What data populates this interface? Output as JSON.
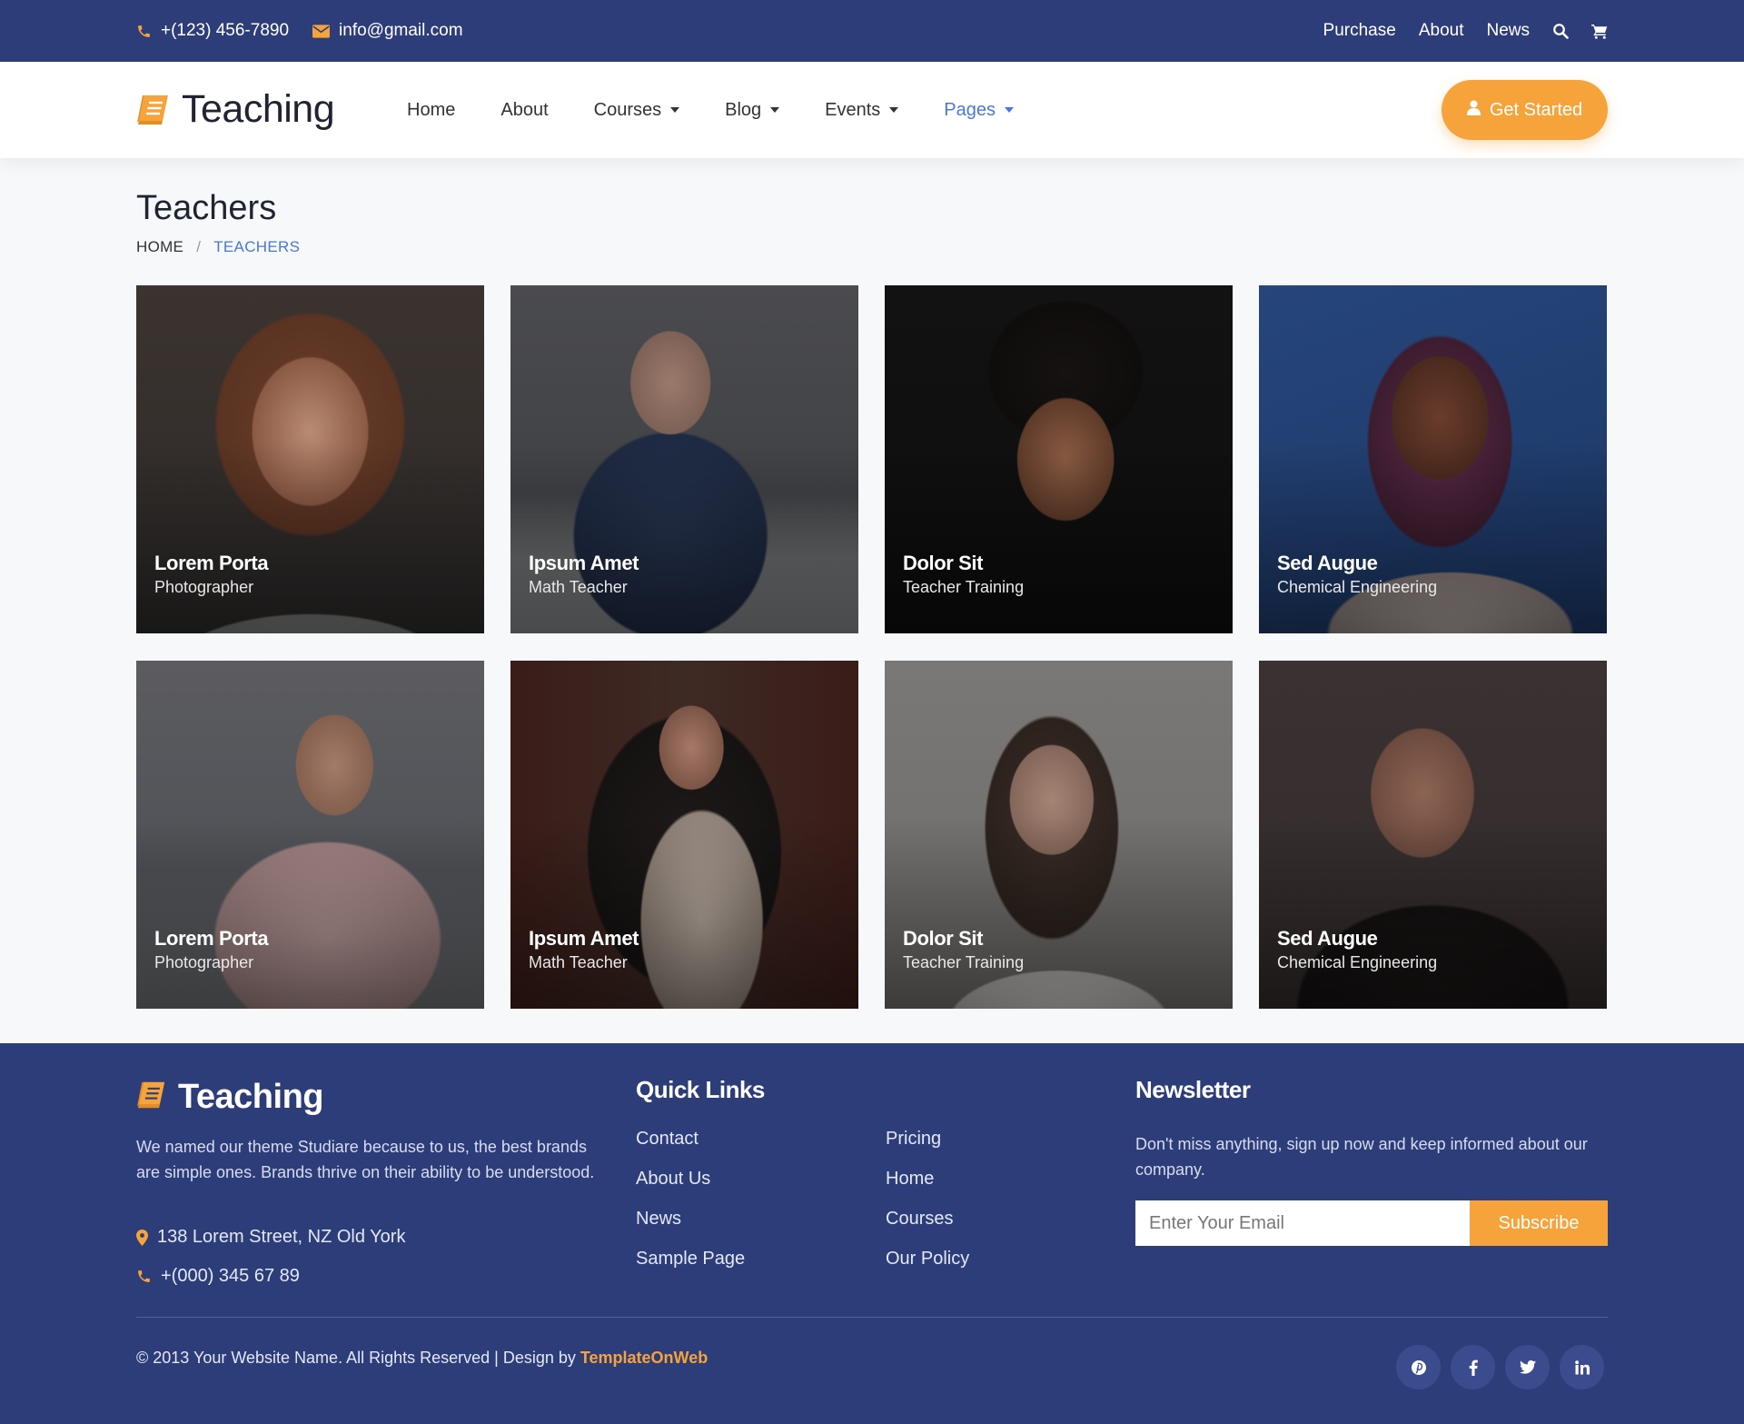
{
  "topbar": {
    "phone": "+(123) 456-7890",
    "email": "info@gmail.com",
    "links": [
      "Purchase",
      "About",
      "News"
    ],
    "icons": [
      "search-icon",
      "cart-icon"
    ]
  },
  "navbar": {
    "brand": "Teaching",
    "menu": [
      {
        "label": "Home",
        "dropdown": false
      },
      {
        "label": "About",
        "dropdown": false
      },
      {
        "label": "Courses",
        "dropdown": true
      },
      {
        "label": "Blog",
        "dropdown": true
      },
      {
        "label": "Events",
        "dropdown": true
      },
      {
        "label": "Pages",
        "dropdown": true,
        "active": true
      }
    ],
    "cta_label": "Get Started"
  },
  "page": {
    "title": "Teachers",
    "breadcrumb": {
      "home": "HOME",
      "separator": "/",
      "current": "TEACHERS"
    }
  },
  "teachers": [
    {
      "name": "Lorem Porta",
      "role": "Photographer"
    },
    {
      "name": "Ipsum Amet",
      "role": "Math Teacher"
    },
    {
      "name": "Dolor Sit",
      "role": "Teacher Training"
    },
    {
      "name": "Sed Augue",
      "role": "Chemical Engineering"
    },
    {
      "name": "Lorem Porta",
      "role": "Photographer"
    },
    {
      "name": "Ipsum Amet",
      "role": "Math Teacher"
    },
    {
      "name": "Dolor Sit",
      "role": "Teacher Training"
    },
    {
      "name": "Sed Augue",
      "role": "Chemical Engineering"
    }
  ],
  "footer": {
    "brand": "Teaching",
    "about": "We named our theme Studiare because to us, the best brands are simple ones. Brands thrive on their ability to be understood.",
    "address": "138 Lorem Street, NZ Old York",
    "phone": "+(000) 345 67 89",
    "quick_links_title": "Quick Links",
    "quick_links_col1": [
      "Contact",
      "About Us",
      "News",
      "Sample Page"
    ],
    "quick_links_col2": [
      "Pricing",
      "Home",
      "Courses",
      "Our Policy"
    ],
    "newsletter_title": "Newsletter",
    "newsletter_text": "Don't miss anything, sign up now and keep informed about our company.",
    "email_placeholder": "Enter Your Email",
    "subscribe_label": "Subscribe",
    "copyright_prefix": "© 2013 Your Website Name. All Rights Reserved | Design by ",
    "copyright_credit": "TemplateOnWeb",
    "social": [
      "pinterest-icon",
      "facebook-icon",
      "twitter-icon",
      "linkedin-icon"
    ]
  },
  "colors": {
    "primary": "#2d3d7a",
    "accent": "#f6a33b",
    "link_active": "#4a78d6"
  }
}
